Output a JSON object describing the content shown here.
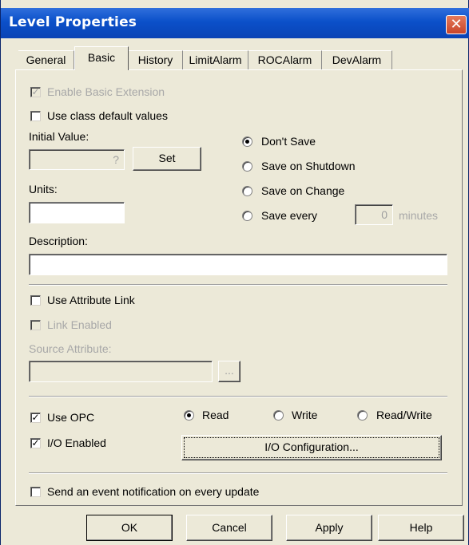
{
  "window": {
    "title": "Level Properties",
    "close_glyph": "✕"
  },
  "tabs": [
    "General",
    "Basic",
    "History",
    "LimitAlarm",
    "ROCAlarm",
    "DevAlarm"
  ],
  "active_tab": "Basic",
  "basic": {
    "enable_basic_extension": {
      "label": "Enable Basic Extension",
      "checked": true,
      "enabled": false
    },
    "use_class_default": {
      "label": "Use class default values",
      "checked": false
    },
    "initial_value": {
      "label": "Initial Value:",
      "value": "?"
    },
    "set_button": "Set",
    "save_options": [
      "Don't Save",
      "Save on Shutdown",
      "Save on Change",
      "Save every"
    ],
    "save_selected": "Don't Save",
    "save_every_value": "0",
    "save_every_unit": "minutes",
    "units": {
      "label": "Units:",
      "value": ""
    },
    "description": {
      "label": "Description:",
      "value": ""
    },
    "use_attribute_link": {
      "label": "Use Attribute Link",
      "checked": false
    },
    "link_enabled": {
      "label": "Link Enabled",
      "checked": false,
      "enabled": false
    },
    "source_attribute": {
      "label": "Source Attribute:",
      "value": "",
      "browse_label": "..."
    },
    "use_opc": {
      "label": "Use OPC",
      "checked": true
    },
    "io_enabled": {
      "label": "I/O Enabled",
      "checked": true
    },
    "opc_modes": [
      "Read",
      "Write",
      "Read/Write"
    ],
    "opc_selected": "Read",
    "io_config_button": "I/O Configuration...",
    "send_event": {
      "label": "Send an event notification on every update",
      "checked": false
    }
  },
  "footer": {
    "ok": "OK",
    "cancel": "Cancel",
    "apply": "Apply",
    "help": "Help"
  }
}
